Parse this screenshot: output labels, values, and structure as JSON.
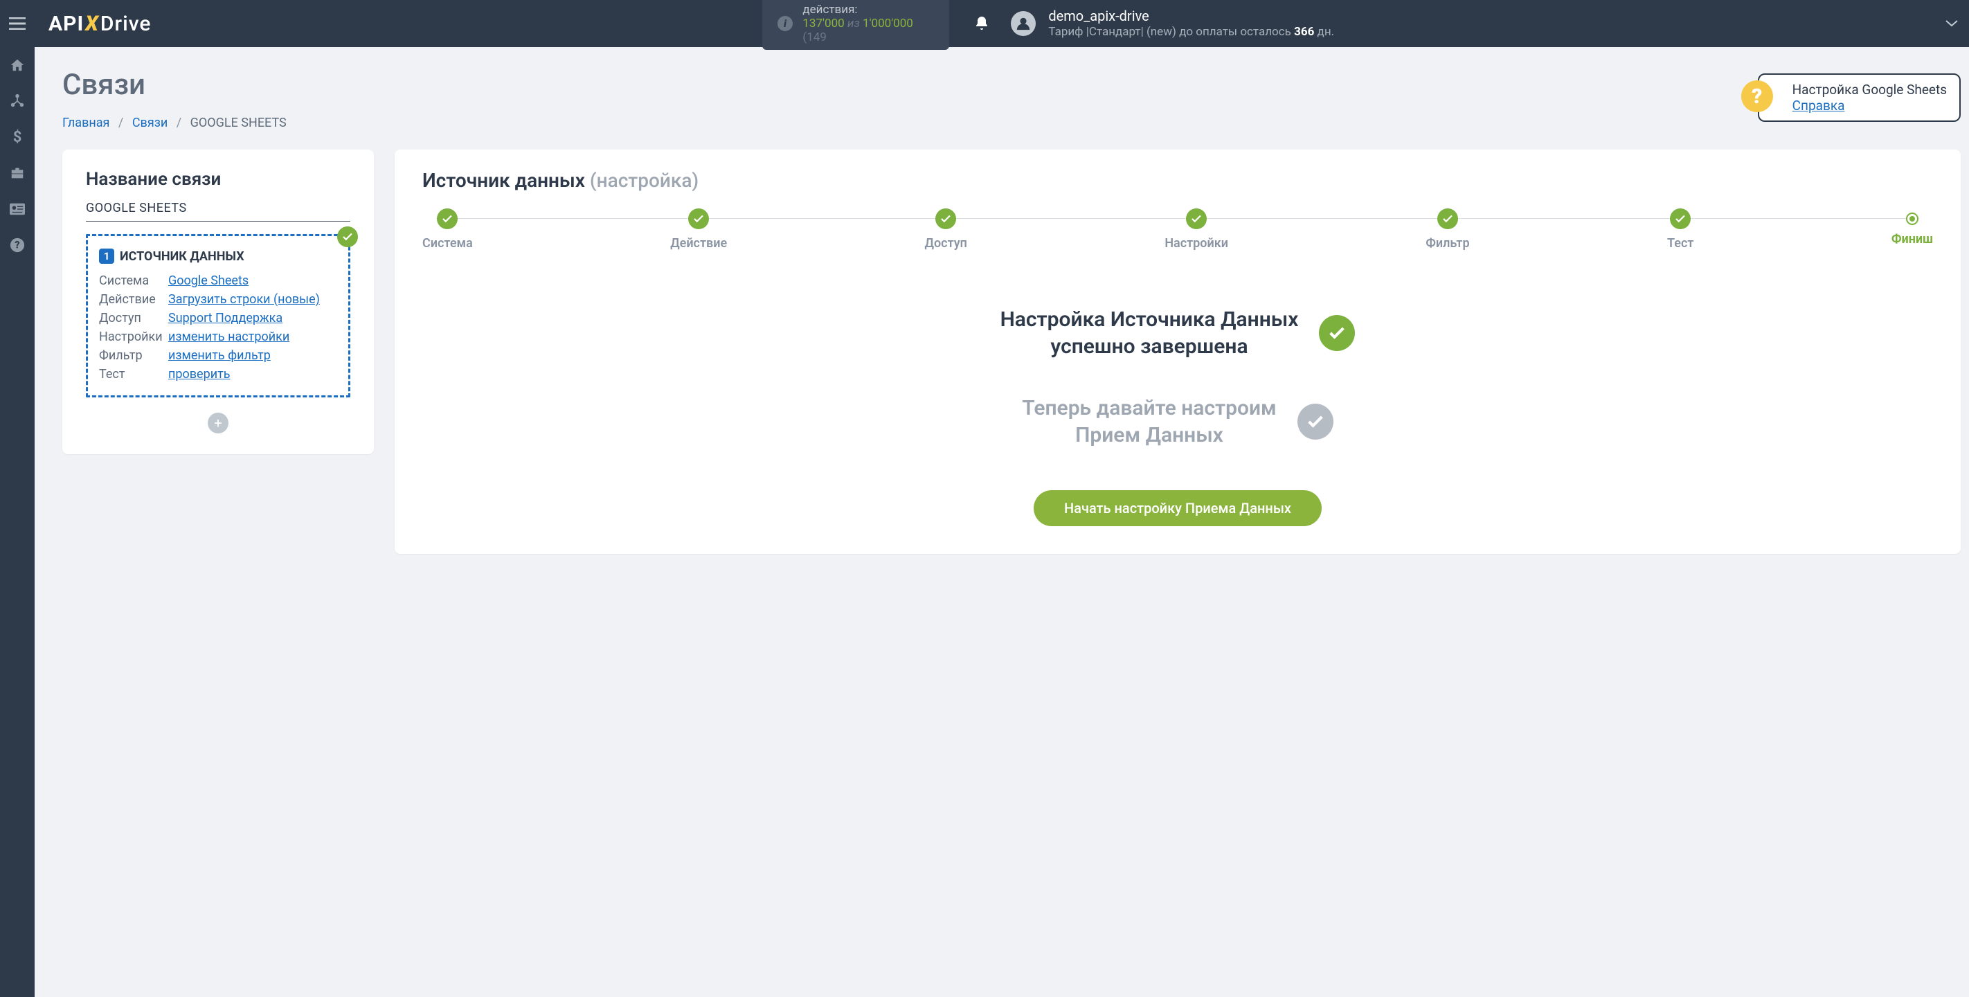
{
  "topbar": {
    "actions_label": "действия:",
    "actions_used": "137'000",
    "actions_of": "из",
    "actions_total": "1'000'000",
    "actions_tail": "(149",
    "user_name": "demo_apix-drive",
    "tariff_prefix": "Тариф |Стандарт| (new) до оплаты осталось ",
    "tariff_days": "366",
    "tariff_suffix": " дн."
  },
  "page": {
    "title": "Связи",
    "breadcrumb_home": "Главная",
    "breadcrumb_links": "Связи",
    "breadcrumb_current": "GOOGLE SHEETS"
  },
  "help": {
    "title": "Настройка Google Sheets",
    "link": "Справка"
  },
  "left_card": {
    "heading": "Название связи",
    "connection_name": "GOOGLE SHEETS",
    "source_badge": "1",
    "source_title": "ИСТОЧНИК ДАННЫХ",
    "rows": [
      {
        "label": "Система",
        "value": "Google Sheets"
      },
      {
        "label": "Действие",
        "value": "Загрузить строки (новые)"
      },
      {
        "label": "Доступ",
        "value": "Support Поддержка"
      },
      {
        "label": "Настройки",
        "value": "изменить настройки"
      },
      {
        "label": "Фильтр",
        "value": "изменить фильтр"
      },
      {
        "label": "Тест",
        "value": "проверить"
      }
    ]
  },
  "right_card": {
    "heading_main": "Источник данных ",
    "heading_gray": "(настройка)",
    "steps": [
      {
        "label": "Система"
      },
      {
        "label": "Действие"
      },
      {
        "label": "Доступ"
      },
      {
        "label": "Настройки"
      },
      {
        "label": "Фильтр"
      },
      {
        "label": "Тест"
      },
      {
        "label": "Финиш",
        "final": true
      }
    ],
    "success_line1": "Настройка Источника Данных",
    "success_line2": "успешно завершена",
    "pending_line1": "Теперь давайте настроим",
    "pending_line2": "Прием Данных",
    "cta": "Начать настройку Приема Данных"
  }
}
